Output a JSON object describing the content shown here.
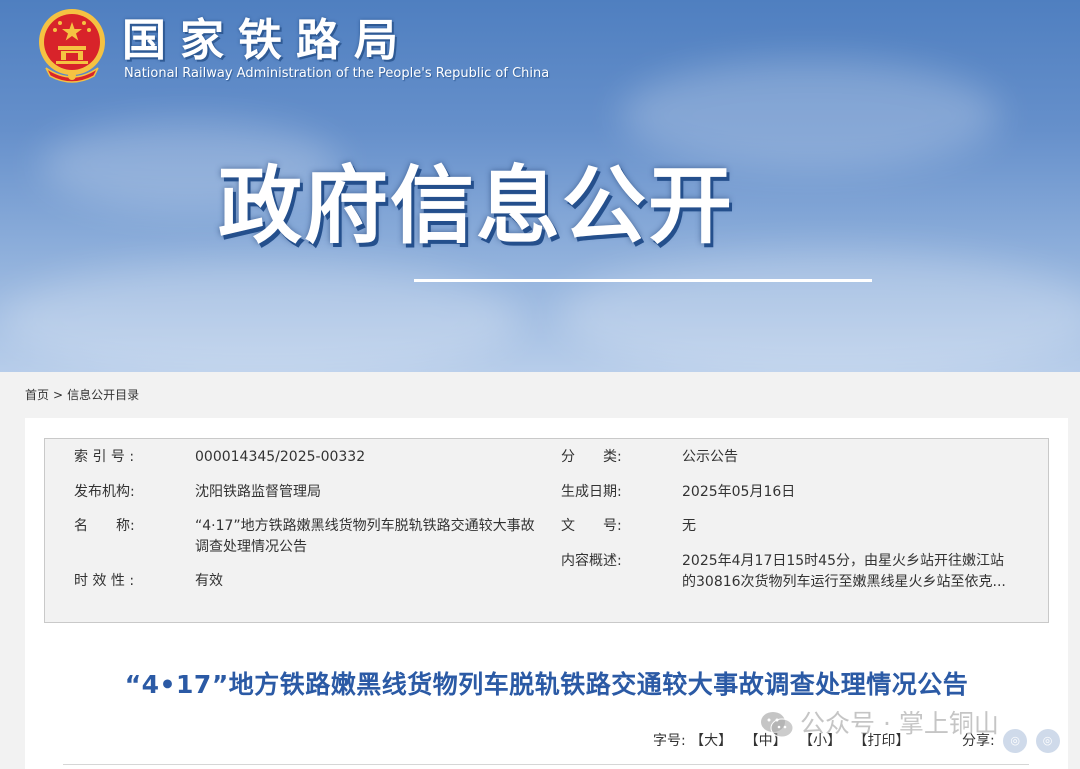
{
  "header": {
    "agency_cn": "国家铁路局",
    "agency_en": "National Railway Administration of the People's Republic of China",
    "hero_title": "政府信息公开"
  },
  "breadcrumb": {
    "home": "首页",
    "separator": ">",
    "current": "信息公开目录"
  },
  "meta": {
    "index_label": "索 引 号 :",
    "index_value": "000014345/2025-00332",
    "category_label": "分　　类:",
    "category_value": "公示公告",
    "publisher_label": "发布机构:",
    "publisher_value": "沈阳铁路监督管理局",
    "date_label": "生成日期:",
    "date_value": "2025年05月16日",
    "name_label": "名　　称:",
    "name_value": "“4·17”地方铁路嫩黑线货物列车脱轨铁路交通较大事故调查处理情况公告",
    "docno_label": "文　　号:",
    "docno_value": "无",
    "validity_label": "时 效 性 :",
    "validity_value": "有效",
    "summary_label": "内容概述:",
    "summary_value": "2025年4月17日15时45分，由星火乡站开往嫩江站的30816次货物列车运行至嫩黑线星火乡站至依克..."
  },
  "document": {
    "title": "“4•17”地方铁路嫩黑线货物列车脱轨铁路交通较大事故调查处理情况公告"
  },
  "toolbar": {
    "font_label": "字号:",
    "large": "【大】",
    "medium": "【中】",
    "small": "【小】",
    "print": "【打印】",
    "share_label": "分享:"
  },
  "watermark": {
    "text": "公众号 · 掌上铜山"
  },
  "colors": {
    "title_blue": "#2b5aa5",
    "banner_top": "#4f7fc0",
    "banner_bottom": "#b7cdea",
    "emblem_red": "#d8232a",
    "emblem_gold": "#f5c242"
  }
}
